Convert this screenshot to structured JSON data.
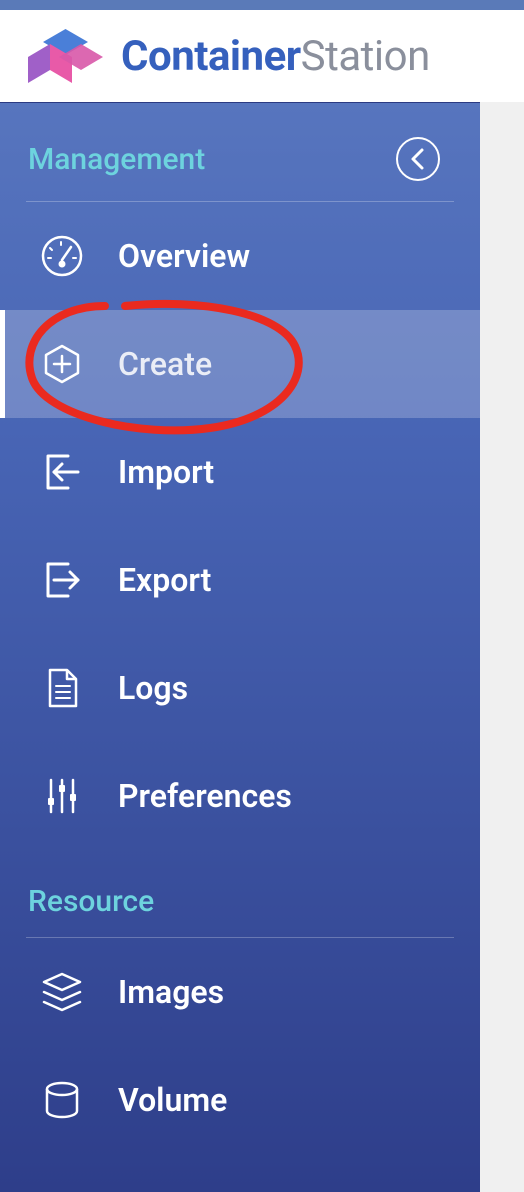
{
  "app": {
    "title_bold": "Container",
    "title_light": "Station"
  },
  "sections": [
    {
      "title": "Management",
      "collapsible": true,
      "items": [
        {
          "id": "overview",
          "icon": "dashboard-icon",
          "label": "Overview",
          "selected": false
        },
        {
          "id": "create",
          "icon": "plus-hexagon-icon",
          "label": "Create",
          "selected": true
        },
        {
          "id": "import",
          "icon": "import-icon",
          "label": "Import",
          "selected": false
        },
        {
          "id": "export",
          "icon": "export-icon",
          "label": "Export",
          "selected": false
        },
        {
          "id": "logs",
          "icon": "document-icon",
          "label": "Logs",
          "selected": false
        },
        {
          "id": "preferences",
          "icon": "sliders-icon",
          "label": "Preferences",
          "selected": false
        }
      ]
    },
    {
      "title": "Resource",
      "collapsible": false,
      "items": [
        {
          "id": "images",
          "icon": "layers-icon",
          "label": "Images",
          "selected": false
        },
        {
          "id": "volume",
          "icon": "cylinder-icon",
          "label": "Volume",
          "selected": false
        }
      ]
    }
  ]
}
